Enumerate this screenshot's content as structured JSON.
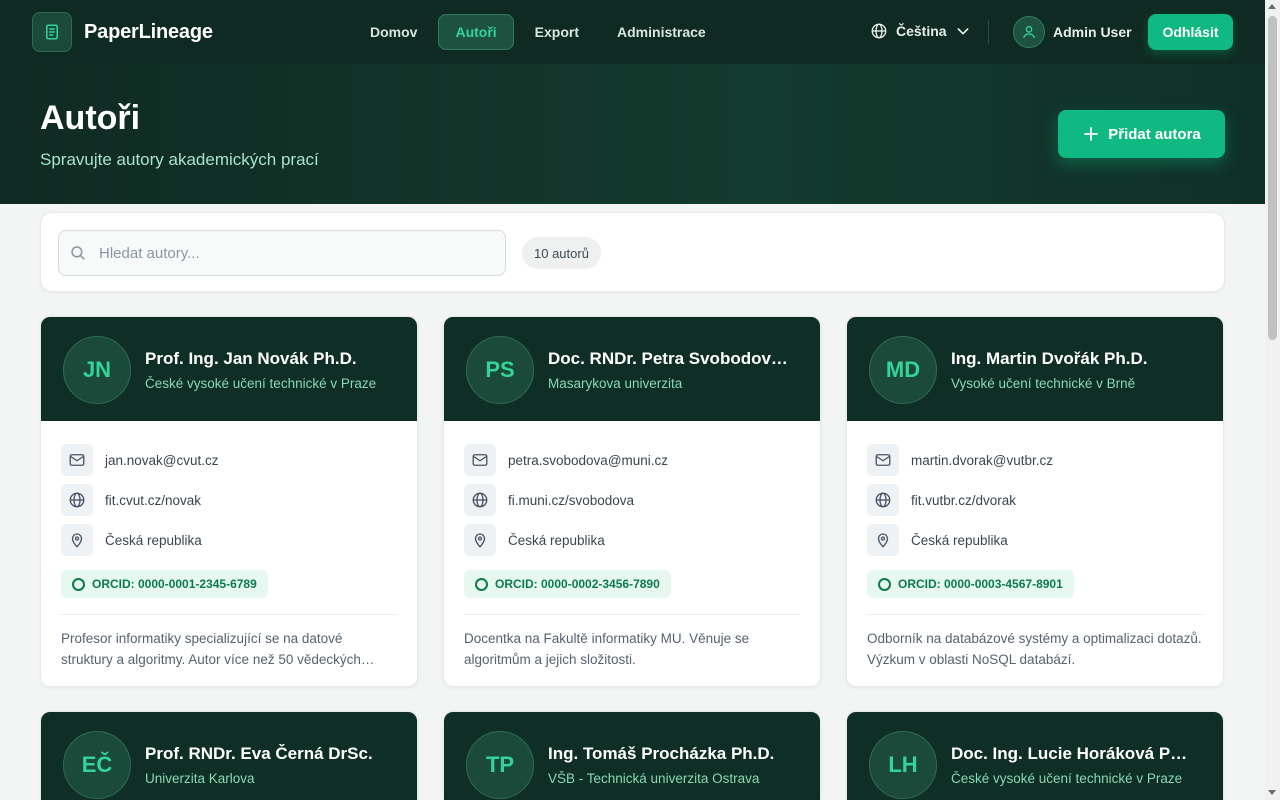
{
  "app": {
    "brand": "PaperLineage",
    "logo_icon": "document-icon"
  },
  "nav": [
    {
      "label": "Domov",
      "active": false
    },
    {
      "label": "Autoři",
      "active": true
    },
    {
      "label": "Export",
      "active": false
    },
    {
      "label": "Administrace",
      "active": false
    }
  ],
  "language": {
    "label": "Čeština"
  },
  "user": {
    "name": "Admin User",
    "logout_label": "Odhlásit"
  },
  "page": {
    "title": "Autoři",
    "subtitle": "Spravujte autory akademických prací",
    "add_button": "Přidat autora"
  },
  "search": {
    "placeholder": "Hledat autory...",
    "value": "",
    "count": "10 autorů"
  },
  "authors": [
    {
      "initials": "JN",
      "name": "Prof. Ing. Jan Novák Ph.D.",
      "university": "České vysoké učení technické v Praze",
      "email": "jan.novak@cvut.cz",
      "website": "fit.cvut.cz/novak",
      "country": "Česká republika",
      "orcid": "ORCID: 0000-0001-2345-6789",
      "description": "Profesor informatiky specializující se na datové struktury a algoritmy. Autor více než 50 vědeckých…"
    },
    {
      "initials": "PS",
      "name": "Doc. RNDr. Petra Svobodov…",
      "university": "Masarykova univerzita",
      "email": "petra.svobodova@muni.cz",
      "website": "fi.muni.cz/svobodova",
      "country": "Česká republika",
      "orcid": "ORCID: 0000-0002-3456-7890",
      "description": "Docentka na Fakultě informatiky MU. Věnuje se algoritmům a jejich složitosti."
    },
    {
      "initials": "MD",
      "name": "Ing. Martin Dvořák Ph.D.",
      "university": "Vysoké učení technické v Brně",
      "email": "martin.dvorak@vutbr.cz",
      "website": "fit.vutbr.cz/dvorak",
      "country": "Česká republika",
      "orcid": "ORCID: 0000-0003-4567-8901",
      "description": "Odborník na databázové systémy a optimalizaci dotazů. Výzkum v oblasti NoSQL databází."
    },
    {
      "initials": "EČ",
      "name": "Prof. RNDr. Eva Černá DrSc.",
      "university": "Univerzita Karlova"
    },
    {
      "initials": "TP",
      "name": "Ing. Tomáš Procházka Ph.D.",
      "university": "VŠB - Technická univerzita Ostrava"
    },
    {
      "initials": "LH",
      "name": "Doc. Ing. Lucie Horáková P…",
      "university": "České vysoké učení technické v Praze"
    }
  ],
  "colors": {
    "accent": "#10b981",
    "header_bg": "#0f2a22",
    "card_head_bg": "#0f2e25",
    "initials": "#34d399"
  }
}
